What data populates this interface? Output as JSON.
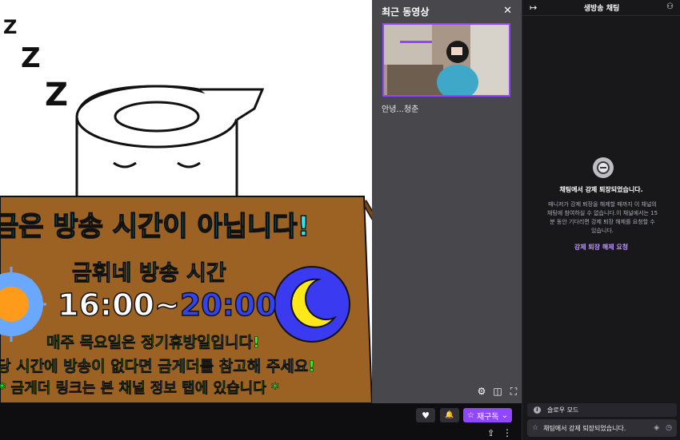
{
  "player": {
    "sign": {
      "title": "금은 방송 시간이 아닙니다!",
      "schedule_label": "금휘네 방송 시간",
      "time_start": "16:00~",
      "time_end": "20:00",
      "note_closed": "매주 목요일은 정기휴방일입니다!",
      "note_calendar": "당 시간에 방송이 없다면 금게더를 참고해 주세요!",
      "note_link": "* 금게더 링크는 본 채널 정보 탭에 있습니다 *"
    },
    "sleep_text": [
      "Z",
      "Z",
      "Z"
    ]
  },
  "recent": {
    "title": "최근 동영상",
    "close": "✕",
    "video_title": "안녕...청춘"
  },
  "controls": {
    "settings": "⚙",
    "theater": "◫",
    "fullscreen": "⛶",
    "heart": "♥",
    "bell": "🔔",
    "subscribe_label": "재구독",
    "subscribe_star": "☆",
    "subscribe_chevron": "⌄",
    "share": "⇪",
    "more": "⋮"
  },
  "chat": {
    "title": "생방송 채팅",
    "collapse": "↦",
    "users": "⚇",
    "ban_heading": "채팅에서 강제 퇴장되었습니다.",
    "ban_message": "매니저가 강제 퇴장을 해제할 때까지 이 채널의 채팅에 참여하실 수 없습니다.이 채널에서는 15분 동안 기다리면 강제 퇴장 해제를 요청할 수 있습니다.",
    "unban_link": "강제 퇴장 해제 요청",
    "slow_mode": "슬로우 모드",
    "slow_mode_icon": "i",
    "input_text": "채팅에서 강제 퇴장되었습니다.",
    "input_star": "☆",
    "input_drop": "◈",
    "input_clock": "◷"
  },
  "colors": {
    "accent": "#9147ff",
    "sign_brown": "#9b6223",
    "sign_cyan": "#2ee6f0",
    "sign_green": "#2bff2b"
  }
}
